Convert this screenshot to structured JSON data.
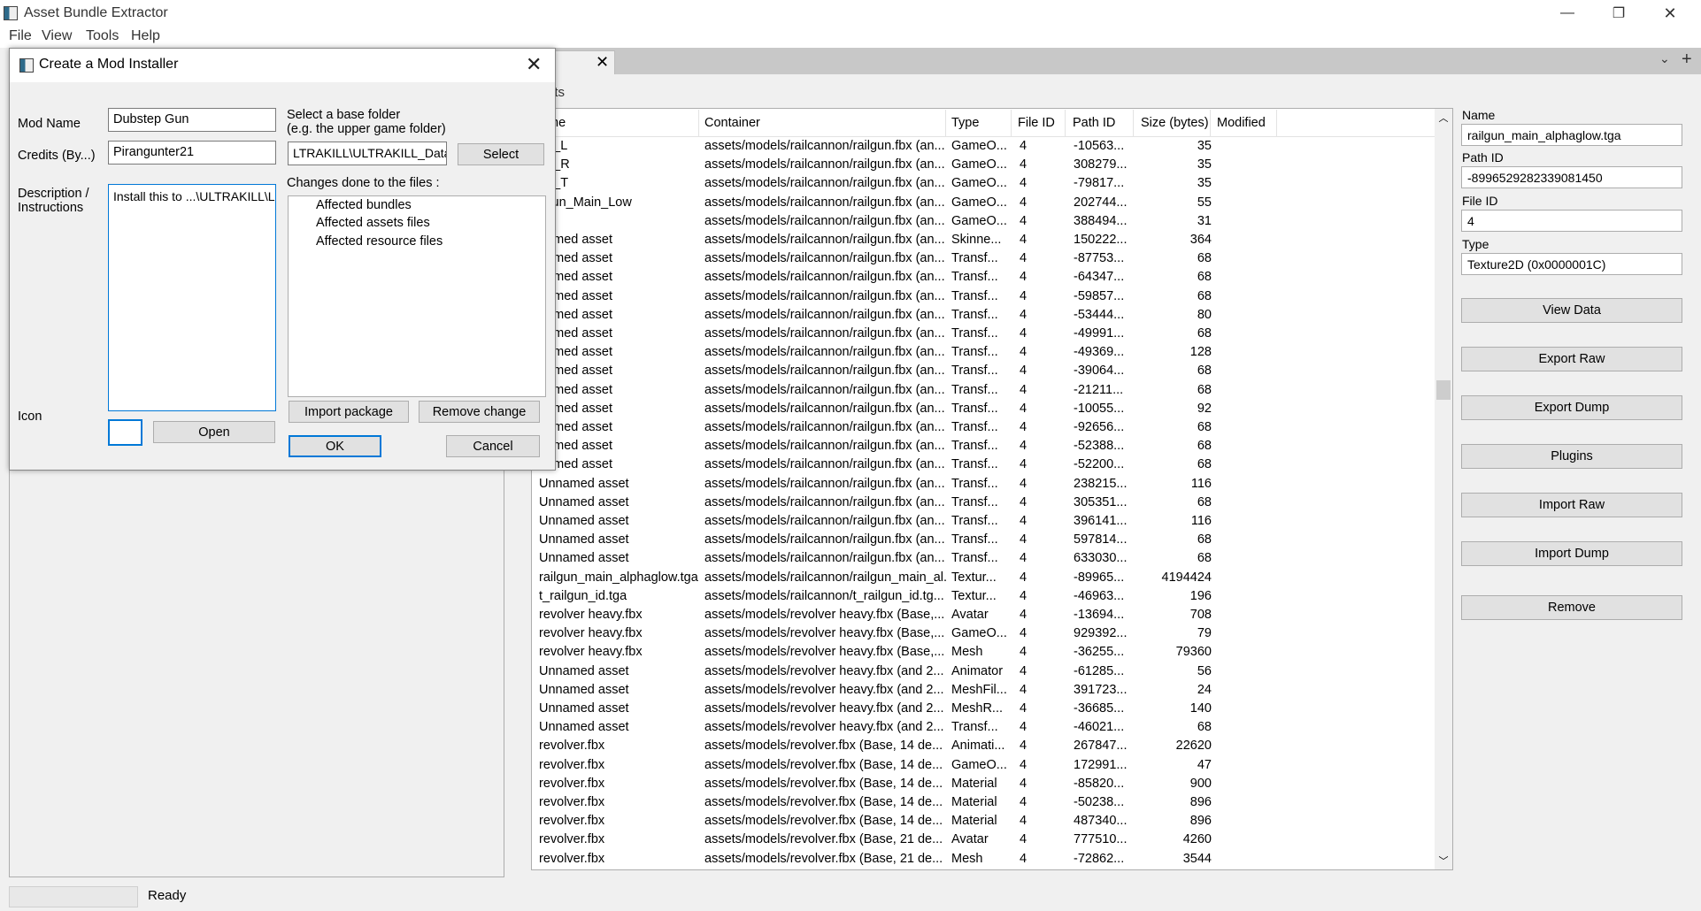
{
  "app": {
    "title": "Asset Bundle Extractor"
  },
  "window_controls": {
    "minimize": "—",
    "maximize": "❐",
    "close": "✕"
  },
  "menu": [
    "File",
    "View",
    "Tools",
    "Help"
  ],
  "tab": {
    "close": "✕",
    "menu": "⌄",
    "add": "+"
  },
  "assets_label": "ets",
  "table": {
    "headers": [
      "me",
      "Container",
      "Type",
      "File ID",
      "Path ID",
      "Size (bytes)",
      "Modified"
    ],
    "rows": [
      [
        "ng_L",
        "assets/models/railcannon/railgun.fbx (an...",
        "GameO...",
        "4",
        "-10563...",
        "35"
      ],
      [
        "ng_R",
        "assets/models/railcannon/railgun.fbx (an...",
        "GameO...",
        "4",
        "308279...",
        "35"
      ],
      [
        "ng_T",
        "assets/models/railcannon/railgun.fbx (an...",
        "GameO...",
        "4",
        "-79817...",
        "35"
      ],
      [
        "ilgun_Main_Low",
        "assets/models/railcannon/railgun.fbx (an...",
        "GameO...",
        "4",
        "202744...",
        "55"
      ],
      [
        "e",
        "assets/models/railcannon/railgun.fbx (an...",
        "GameO...",
        "4",
        "388494...",
        "31"
      ],
      [
        "named asset",
        "assets/models/railcannon/railgun.fbx (an...",
        "Skinne...",
        "4",
        "150222...",
        "364"
      ],
      [
        "named asset",
        "assets/models/railcannon/railgun.fbx (an...",
        "Transf...",
        "4",
        "-87753...",
        "68"
      ],
      [
        "named asset",
        "assets/models/railcannon/railgun.fbx (an...",
        "Transf...",
        "4",
        "-64347...",
        "68"
      ],
      [
        "named asset",
        "assets/models/railcannon/railgun.fbx (an...",
        "Transf...",
        "4",
        "-59857...",
        "68"
      ],
      [
        "named asset",
        "assets/models/railcannon/railgun.fbx (an...",
        "Transf...",
        "4",
        "-53444...",
        "80"
      ],
      [
        "named asset",
        "assets/models/railcannon/railgun.fbx (an...",
        "Transf...",
        "4",
        "-49991...",
        "68"
      ],
      [
        "named asset",
        "assets/models/railcannon/railgun.fbx (an...",
        "Transf...",
        "4",
        "-49369...",
        "128"
      ],
      [
        "named asset",
        "assets/models/railcannon/railgun.fbx (an...",
        "Transf...",
        "4",
        "-39064...",
        "68"
      ],
      [
        "named asset",
        "assets/models/railcannon/railgun.fbx (an...",
        "Transf...",
        "4",
        "-21211...",
        "68"
      ],
      [
        "named asset",
        "assets/models/railcannon/railgun.fbx (an...",
        "Transf...",
        "4",
        "-10055...",
        "92"
      ],
      [
        "named asset",
        "assets/models/railcannon/railgun.fbx (an...",
        "Transf...",
        "4",
        "-92656...",
        "68"
      ],
      [
        "named asset",
        "assets/models/railcannon/railgun.fbx (an...",
        "Transf...",
        "4",
        "-52388...",
        "68"
      ],
      [
        "named asset",
        "assets/models/railcannon/railgun.fbx (an...",
        "Transf...",
        "4",
        "-52200...",
        "68"
      ],
      [
        "Unnamed asset",
        "assets/models/railcannon/railgun.fbx (an...",
        "Transf...",
        "4",
        "238215...",
        "116"
      ],
      [
        "Unnamed asset",
        "assets/models/railcannon/railgun.fbx (an...",
        "Transf...",
        "4",
        "305351...",
        "68"
      ],
      [
        "Unnamed asset",
        "assets/models/railcannon/railgun.fbx (an...",
        "Transf...",
        "4",
        "396141...",
        "116"
      ],
      [
        "Unnamed asset",
        "assets/models/railcannon/railgun.fbx (an...",
        "Transf...",
        "4",
        "597814...",
        "68"
      ],
      [
        "Unnamed asset",
        "assets/models/railcannon/railgun.fbx (an...",
        "Transf...",
        "4",
        "633030...",
        "68"
      ],
      [
        "railgun_main_alphaglow.tga",
        "assets/models/railcannon/railgun_main_al...",
        "Textur...",
        "4",
        "-89965...",
        "4194424"
      ],
      [
        "t_railgun_id.tga",
        "assets/models/railcannon/t_railgun_id.tg...",
        "Textur...",
        "4",
        "-46963...",
        "196"
      ],
      [
        "revolver heavy.fbx",
        "assets/models/revolver heavy.fbx (Base,...",
        "Avatar",
        "4",
        "-13694...",
        "708"
      ],
      [
        "revolver heavy.fbx",
        "assets/models/revolver heavy.fbx (Base,...",
        "GameO...",
        "4",
        "929392...",
        "79"
      ],
      [
        "revolver heavy.fbx",
        "assets/models/revolver heavy.fbx (Base,...",
        "Mesh",
        "4",
        "-36255...",
        "79360"
      ],
      [
        "Unnamed asset",
        "assets/models/revolver heavy.fbx (and 2...",
        "Animator",
        "4",
        "-61285...",
        "56"
      ],
      [
        "Unnamed asset",
        "assets/models/revolver heavy.fbx (and 2...",
        "MeshFil...",
        "4",
        "391723...",
        "24"
      ],
      [
        "Unnamed asset",
        "assets/models/revolver heavy.fbx (and 2...",
        "MeshR...",
        "4",
        "-36685...",
        "140"
      ],
      [
        "Unnamed asset",
        "assets/models/revolver heavy.fbx (and 2...",
        "Transf...",
        "4",
        "-46021...",
        "68"
      ],
      [
        "revolver.fbx",
        "assets/models/revolver.fbx (Base, 14 de...",
        "Animati...",
        "4",
        "267847...",
        "22620"
      ],
      [
        "revolver.fbx",
        "assets/models/revolver.fbx (Base, 14 de...",
        "GameO...",
        "4",
        "172991...",
        "47"
      ],
      [
        "revolver.fbx",
        "assets/models/revolver.fbx (Base, 14 de...",
        "Material",
        "4",
        "-85820...",
        "900"
      ],
      [
        "revolver.fbx",
        "assets/models/revolver.fbx (Base, 14 de...",
        "Material",
        "4",
        "-50238...",
        "896"
      ],
      [
        "revolver.fbx",
        "assets/models/revolver.fbx (Base, 14 de...",
        "Material",
        "4",
        "487340...",
        "896"
      ],
      [
        "revolver.fbx",
        "assets/models/revolver.fbx (Base, 21 de...",
        "Avatar",
        "4",
        "777510...",
        "4260"
      ],
      [
        "revolver.fbx",
        "assets/models/revolver.fbx (Base, 21 de...",
        "Mesh",
        "4",
        "-72862...",
        "3544"
      ]
    ]
  },
  "info": {
    "name_label": "Name",
    "name_value": "railgun_main_alphaglow.tga",
    "pathid_label": "Path ID",
    "pathid_value": "-8996529282339081450",
    "fileid_label": "File ID",
    "fileid_value": "4",
    "type_label": "Type",
    "type_value": "Texture2D (0x0000001C)"
  },
  "actions": [
    "View Data",
    "Export Raw",
    "Export Dump",
    "Plugins",
    "Import Raw",
    "Import Dump",
    "Remove"
  ],
  "status": {
    "text": "Ready"
  },
  "dialog": {
    "title": "Create a Mod Installer",
    "close": "✕",
    "mod_name_label": "Mod Name",
    "mod_name_value": "Dubstep Gun",
    "credits_label": "Credits (By...)",
    "credits_value": "Pirangunter21",
    "desc_label_1": "Description /",
    "desc_label_2": "Instructions",
    "desc_value": "Install this to ...\\ULTRAKILL\\L",
    "icon_label": "Icon",
    "open_button": "Open",
    "base_folder_label_1": "Select a base folder",
    "base_folder_label_2": "(e.g. the upper game folder)",
    "base_folder_value": "LTRAKILL\\ULTRAKILL_Data",
    "select_button": "Select",
    "changes_label": "Changes done to the files :",
    "changes_tree": [
      "Affected bundles",
      "Affected assets files",
      "Affected resource files"
    ],
    "import_package": "Import package",
    "remove_change": "Remove change",
    "ok": "OK",
    "cancel": "Cancel"
  }
}
